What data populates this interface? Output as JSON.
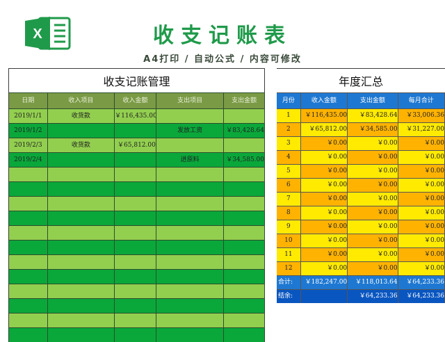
{
  "header": {
    "title": "收支记账表",
    "subtitle": "A4打印 / 自动公式 / 内容可修改",
    "logo_icon": "excel-icon",
    "logo_letter": "X"
  },
  "colors": {
    "brand_green": "#1f9a4a",
    "row_light": "#92cf4f",
    "row_dark": "#0aa83a",
    "header_olive": "#7a9a45",
    "summary_blue": "#1e78d2",
    "month_yellow": "#ffea00",
    "month_orange": "#ffb300"
  },
  "ledger": {
    "title": "收支记账管理",
    "columns": [
      "日期",
      "收入项目",
      "收入金额",
      "支出项目",
      "支出金额"
    ],
    "rows": [
      [
        "2019/1/1",
        "收货款",
        "￥116,435.00",
        "",
        ""
      ],
      [
        "2019/1/2",
        "",
        "",
        "发放工资",
        "￥83,428.64"
      ],
      [
        "2019/2/3",
        "收货款",
        "￥65,812.00",
        "",
        ""
      ],
      [
        "2019/2/4",
        "",
        "",
        "进原料",
        "￥34,585.00"
      ],
      [
        "",
        "",
        "",
        "",
        ""
      ],
      [
        "",
        "",
        "",
        "",
        ""
      ],
      [
        "",
        "",
        "",
        "",
        ""
      ],
      [
        "",
        "",
        "",
        "",
        ""
      ],
      [
        "",
        "",
        "",
        "",
        ""
      ],
      [
        "",
        "",
        "",
        "",
        ""
      ],
      [
        "",
        "",
        "",
        "",
        ""
      ],
      [
        "",
        "",
        "",
        "",
        ""
      ],
      [
        "",
        "",
        "",
        "",
        ""
      ],
      [
        "",
        "",
        "",
        "",
        ""
      ],
      [
        "",
        "",
        "",
        "",
        ""
      ],
      [
        "",
        "",
        "",
        "",
        ""
      ]
    ]
  },
  "annual": {
    "title": "年度汇总",
    "columns": [
      "月份",
      "收入金额",
      "支出金额",
      "每月合计"
    ],
    "rows": [
      [
        "1",
        "￥116,435.00",
        "￥83,428.64",
        "￥33,006.36"
      ],
      [
        "2",
        "￥65,812.00",
        "￥34,585.00",
        "￥31,227.00"
      ],
      [
        "3",
        "￥0.00",
        "￥0.00",
        "￥0.00"
      ],
      [
        "4",
        "￥0.00",
        "￥0.00",
        "￥0.00"
      ],
      [
        "5",
        "￥0.00",
        "￥0.00",
        "￥0.00"
      ],
      [
        "6",
        "￥0.00",
        "￥0.00",
        "￥0.00"
      ],
      [
        "7",
        "￥0.00",
        "￥0.00",
        "￥0.00"
      ],
      [
        "8",
        "￥0.00",
        "￥0.00",
        "￥0.00"
      ],
      [
        "9",
        "￥0.00",
        "￥0.00",
        "￥0.00"
      ],
      [
        "10",
        "￥0.00",
        "￥0.00",
        "￥0.00"
      ],
      [
        "11",
        "￥0.00",
        "￥0.00",
        "￥0.00"
      ],
      [
        "12",
        "￥0.00",
        "￥0.00",
        "￥0.00"
      ]
    ],
    "total": [
      "合计:",
      "￥182,247.00",
      "￥118,013.64",
      "￥64,233.36"
    ],
    "balance": [
      "结余:",
      "",
      "￥64,233.36",
      "￥64,233.36"
    ]
  }
}
